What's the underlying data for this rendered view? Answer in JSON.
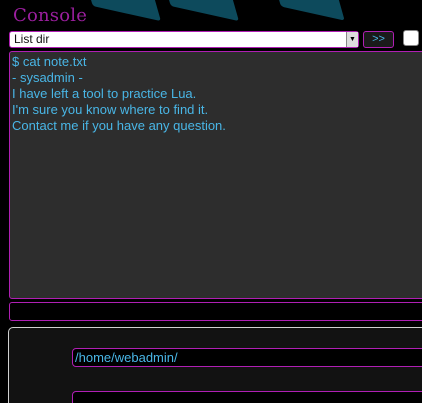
{
  "header": {
    "title": "Console"
  },
  "command": {
    "selected": "List dir",
    "run_label": ">>"
  },
  "output": {
    "lines": [
      "$ cat note.txt",
      "- sysadmin -",
      "I have left a tool to practice Lua.",
      "I'm sure you know where to find it.",
      "Contact me if you have any question."
    ]
  },
  "path": {
    "value": "/home/webadmin/"
  },
  "colors": {
    "accent": "#b01fb4",
    "text": "#49b6e6",
    "title": "#9b1f9e"
  }
}
